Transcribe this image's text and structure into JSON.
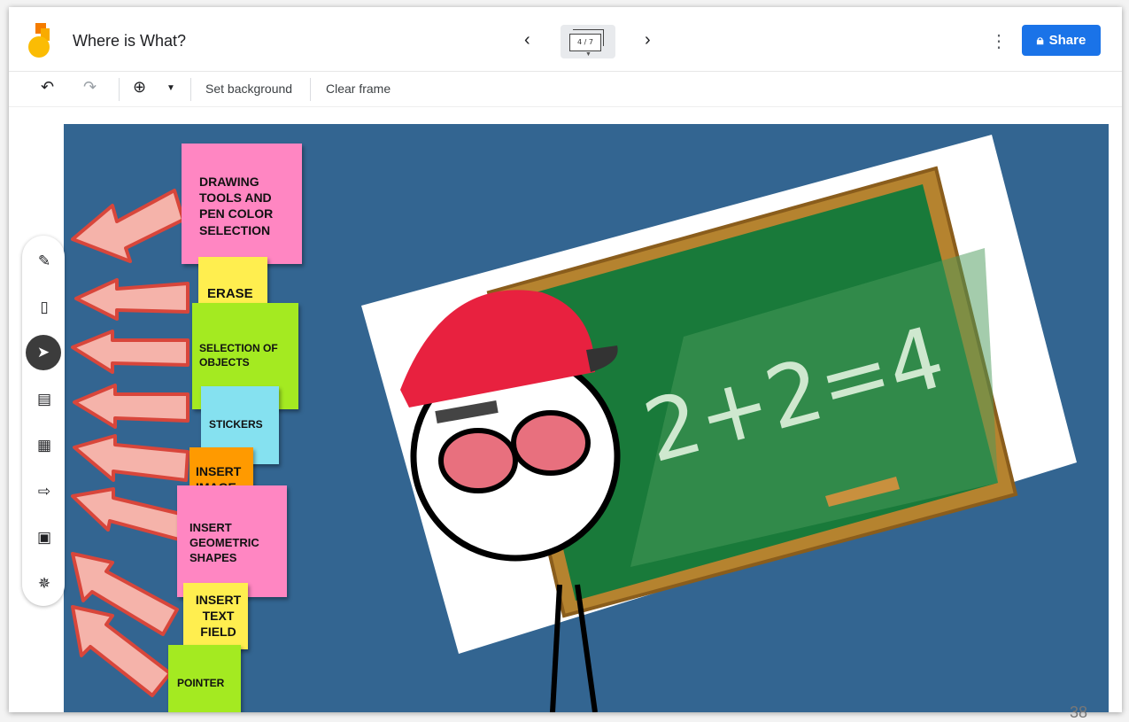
{
  "app": {
    "title": "Where is What?",
    "frame_indicator": "4 / 7",
    "share_label": "Share",
    "accent_color": "#1a73e8"
  },
  "toolbar": {
    "undo_icon": "undo-icon",
    "redo_icon": "redo-icon",
    "zoom_icon": "zoom-in-icon",
    "set_background_label": "Set background",
    "clear_frame_label": "Clear frame"
  },
  "tools": [
    {
      "name": "pen",
      "icon": "pen-icon"
    },
    {
      "name": "eraser",
      "icon": "eraser-icon"
    },
    {
      "name": "select",
      "icon": "pointer-cursor-icon",
      "active": true
    },
    {
      "name": "sticky-note",
      "icon": "sticky-note-icon"
    },
    {
      "name": "image",
      "icon": "image-icon"
    },
    {
      "name": "shape",
      "icon": "shape-icon"
    },
    {
      "name": "text-box",
      "icon": "text-box-icon"
    },
    {
      "name": "laser",
      "icon": "laser-pointer-icon"
    }
  ],
  "notes": {
    "drawing": "DRAWING TOOLS AND PEN COLOR SELECTION",
    "erase": "ERASE",
    "selection": "SELECTION OF OBJECTS",
    "stickers": "STICKERS",
    "insert_image": "INSERT IMAGE",
    "insert_shapes": "INSERT GEOMETRIC SHAPES",
    "insert_text": "INSERT TEXT FIELD",
    "pointer": "POINTER"
  },
  "chalkboard": {
    "equation": "2+2=4"
  },
  "page_number": "38"
}
